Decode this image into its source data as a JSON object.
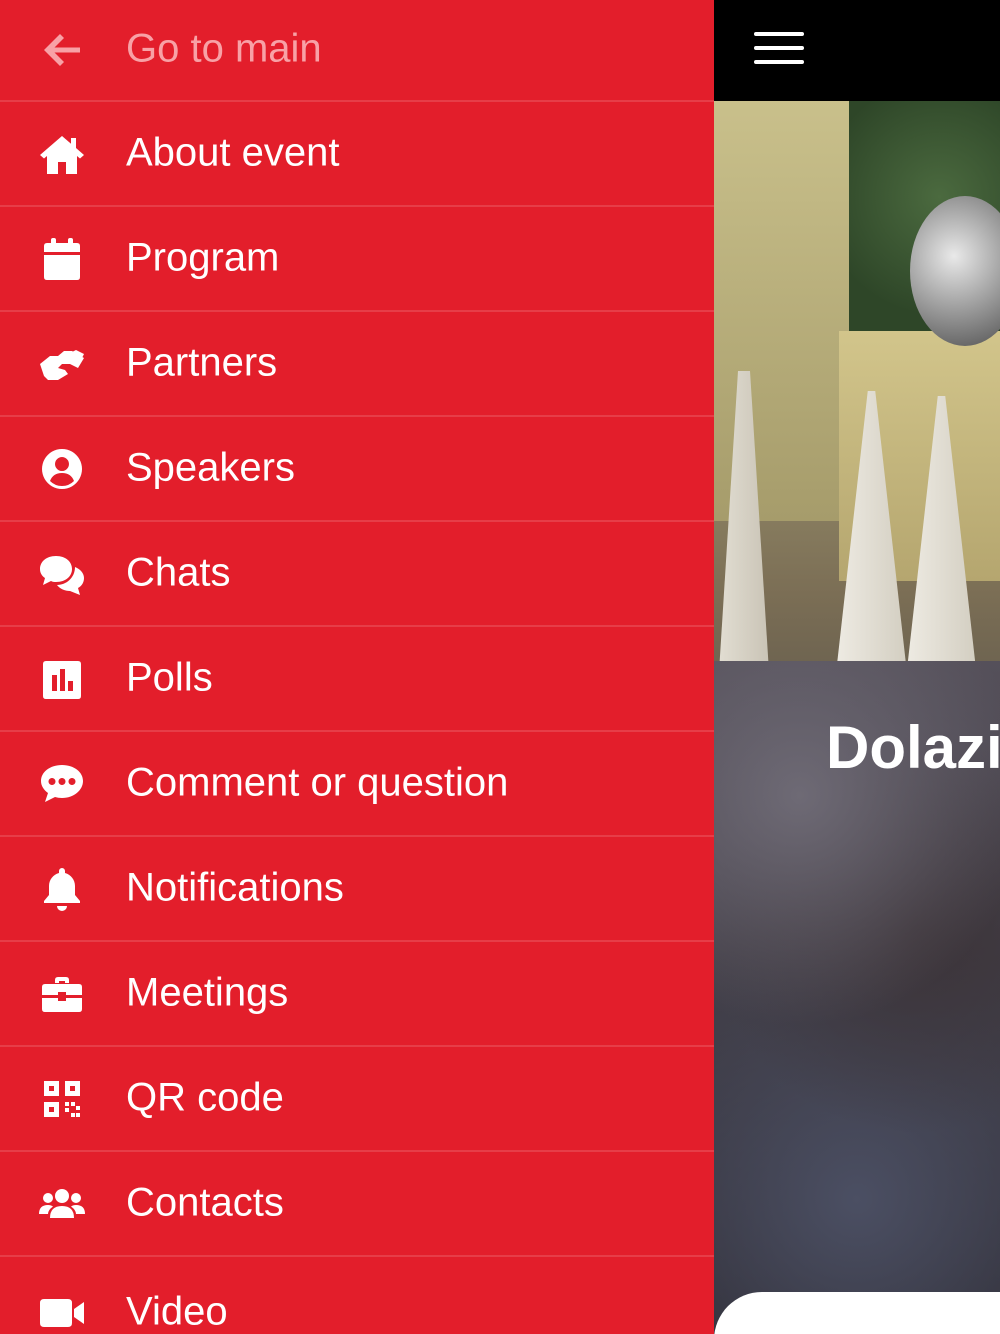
{
  "colors": {
    "drawer_bg": "#e31e2b",
    "back_text": "#f8a1a6",
    "text": "#ffffff",
    "topbar": "#000000"
  },
  "menu": {
    "back": {
      "label": "Go to main",
      "icon": "arrow-left-icon"
    },
    "items": [
      {
        "label": "About event",
        "icon": "home-icon"
      },
      {
        "label": "Program",
        "icon": "calendar-icon"
      },
      {
        "label": "Partners",
        "icon": "handshake-icon"
      },
      {
        "label": "Speakers",
        "icon": "user-circle-icon"
      },
      {
        "label": "Chats",
        "icon": "chat-bubbles-icon"
      },
      {
        "label": "Polls",
        "icon": "poll-chart-icon"
      },
      {
        "label": "Comment or question",
        "icon": "comment-dots-icon"
      },
      {
        "label": "Notifications",
        "icon": "bell-icon"
      },
      {
        "label": "Meetings",
        "icon": "briefcase-icon"
      },
      {
        "label": "QR code",
        "icon": "qr-code-icon"
      },
      {
        "label": "Contacts",
        "icon": "users-icon"
      },
      {
        "label": "Video",
        "icon": "video-camera-icon"
      }
    ]
  },
  "header": {
    "menu_icon": "hamburger-menu-icon"
  },
  "hero": {
    "title": "Dolazi"
  }
}
